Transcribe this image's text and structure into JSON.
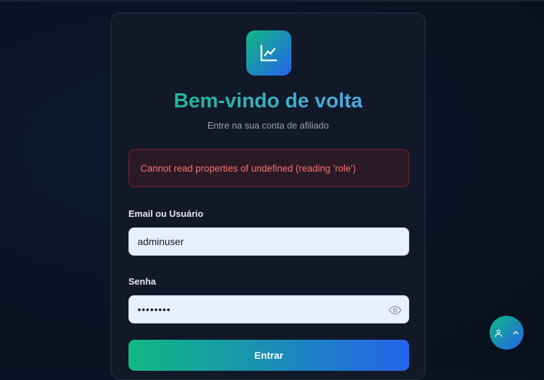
{
  "login": {
    "logo_icon": "chart-line-icon",
    "title": "Bem-vindo de volta",
    "subtitle": "Entre na sua conta de afiliado",
    "error_message": "Cannot read properties of undefined (reading 'role')",
    "email_label": "Email ou Usuário",
    "email_value": "adminuser",
    "password_label": "Senha",
    "password_value": "••••••••",
    "password_toggle_icon": "eye-icon",
    "submit_label": "Entrar"
  },
  "floating_widget": {
    "icons": [
      "user-icon",
      "chevron-up-icon"
    ]
  },
  "colors": {
    "background": "#0a1323",
    "card": "#111827",
    "accent_start": "#10b981",
    "accent_end": "#2563eb",
    "error_text": "#f87171",
    "input_bg": "#e8f0fe"
  }
}
